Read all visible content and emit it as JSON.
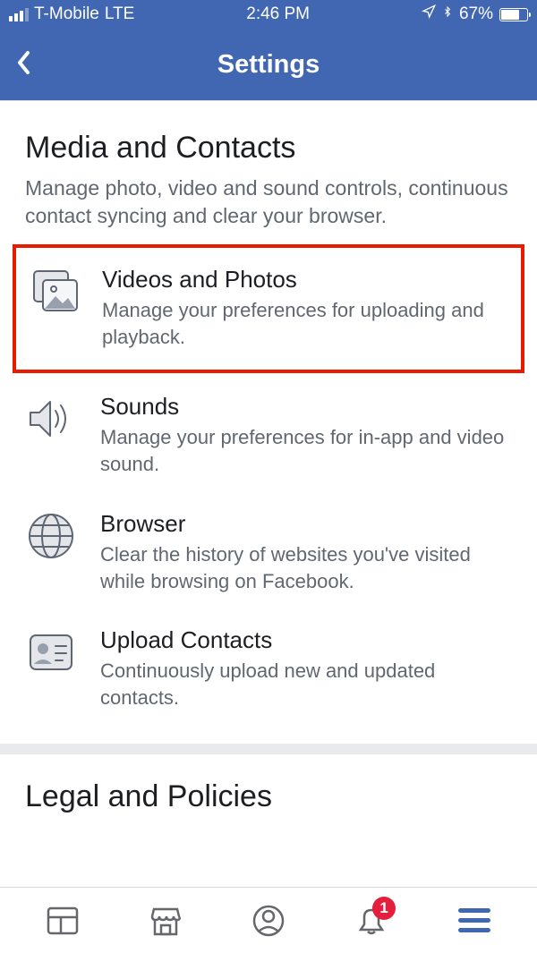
{
  "status": {
    "carrier": "T-Mobile",
    "network": "LTE",
    "time": "2:46 PM",
    "battery_pct": "67%"
  },
  "header": {
    "title": "Settings"
  },
  "section": {
    "title": "Media and Contacts",
    "subtitle": "Manage photo, video and sound controls, continuous contact syncing and clear your browser."
  },
  "items": [
    {
      "icon": "photos-icon",
      "title": "Videos and Photos",
      "desc": "Manage your preferences for uploading and playback.",
      "highlighted": true
    },
    {
      "icon": "sounds-icon",
      "title": "Sounds",
      "desc": "Manage your preferences for in-app and video sound."
    },
    {
      "icon": "browser-icon",
      "title": "Browser",
      "desc": "Clear the history of websites you've visited while browsing on Facebook."
    },
    {
      "icon": "contacts-icon",
      "title": "Upload Contacts",
      "desc": "Continuously upload new and updated contacts."
    }
  ],
  "next_section": {
    "title": "Legal and Policies"
  },
  "tabs": {
    "notification_count": "1"
  }
}
